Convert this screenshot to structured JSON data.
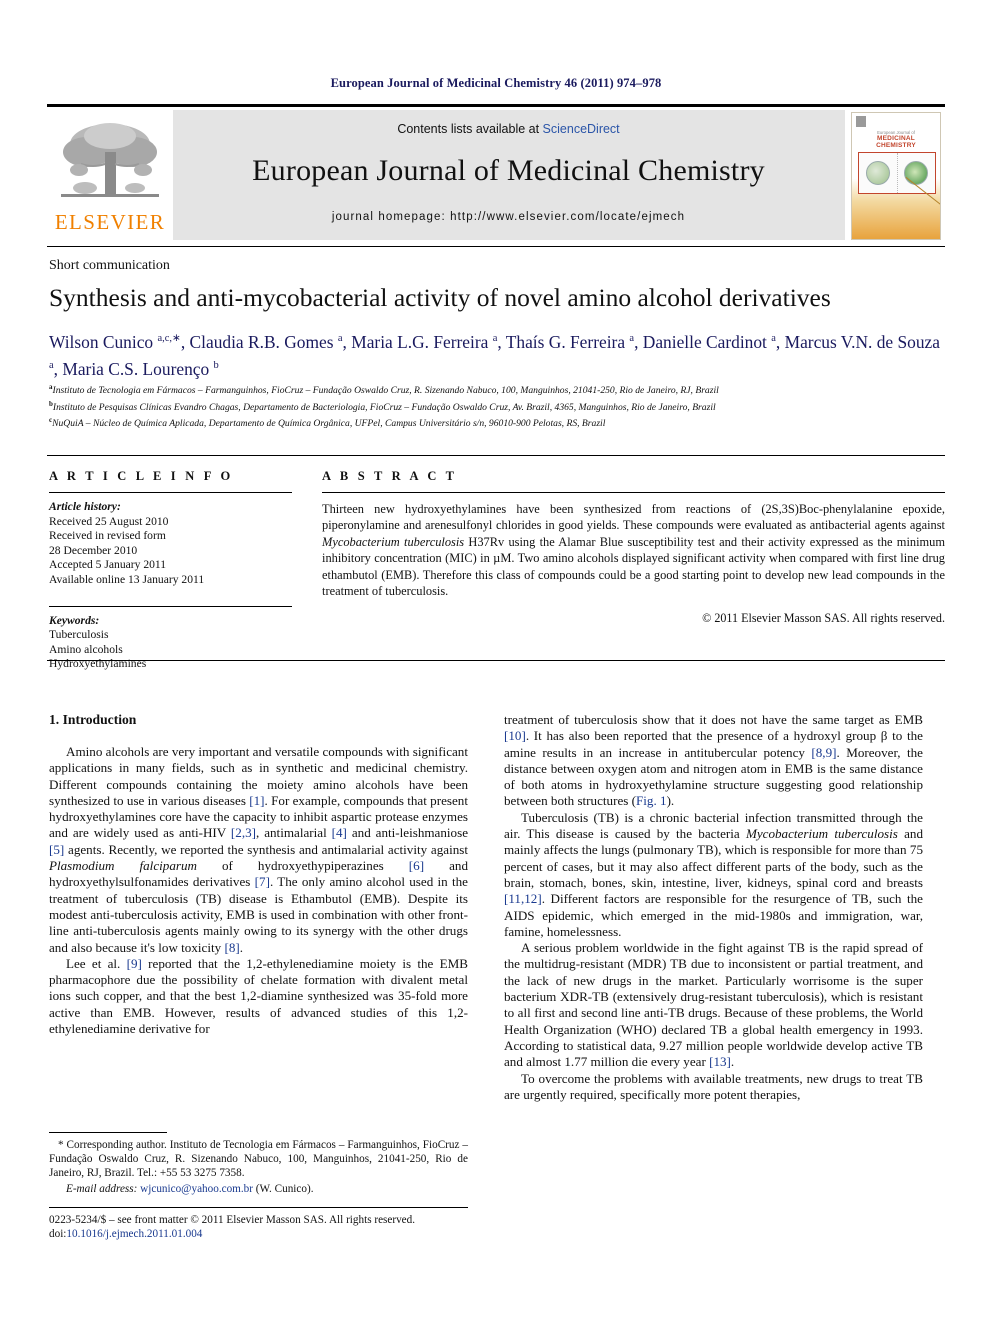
{
  "running_head": "European Journal of Medicinal Chemistry 46 (2011) 974–978",
  "masthead": {
    "publisher_name": "ELSEVIER",
    "contents_prefix": "Contents lists available at ",
    "contents_link": "ScienceDirect",
    "journal_title": "European Journal of Medicinal Chemistry",
    "journal_homepage": "journal homepage: http://www.elsevier.com/locate/ejmech",
    "cover_journal_small": "European Journal of",
    "cover_journal_big": "MEDICINAL CHEMISTRY"
  },
  "article": {
    "type_label": "Short communication",
    "title": "Synthesis and anti-mycobacterial activity of novel amino alcohol derivatives",
    "authors_html": "Wilson Cunico <sup>a,c,∗</sup>, Claudia R.B. Gomes <sup>a</sup>, Maria L.G. Ferreira <sup>a</sup>, Thaís G. Ferreira <sup>a</sup>, Danielle Cardinot <sup>a</sup>, Marcus V.N. de Souza <sup>a</sup>, Maria C.S. Lourenço <sup>b</sup>",
    "affiliations": [
      "Instituto de Tecnologia em Fármacos – Farmanguinhos, FioCruz – Fundação Oswaldo Cruz, R. Sizenando Nabuco, 100, Manguinhos, 21041-250, Rio de Janeiro, RJ, Brazil",
      "Instituto de Pesquisas Clínicas Evandro Chagas, Departamento de Bacteriologia, FioCruz – Fundação Oswaldo Cruz, Av. Brazil, 4365, Manguinhos, Rio de Janeiro, Brazil",
      "NuQuiA – Núcleo de Química Aplicada, Departamento de Química Orgânica, UFPel, Campus Universitário s/n, 96010-900 Pelotas, RS, Brazil"
    ],
    "affiliation_marks": [
      "a",
      "b",
      "c"
    ]
  },
  "article_info": {
    "label": "A R T I C L E    I N F O",
    "history_header": "Article history:",
    "history": [
      "Received 25 August 2010",
      "Received in revised form",
      "28 December 2010",
      "Accepted 5 January 2011",
      "Available online 13 January 2011"
    ],
    "keywords_header": "Keywords:",
    "keywords": [
      "Tuberculosis",
      "Amino alcohols",
      "Hydroxyethylamines"
    ]
  },
  "abstract": {
    "label": "A B S T R A C T",
    "paragraph_html": "Thirteen new hydroxyethylamines have been synthesized from reactions of (2S,3S)Boc-phenylalanine epoxide, piperonylamine and arenesulfonyl chlorides in good yields. These compounds were evaluated as antibacterial agents against <i>Mycobacterium tuberculosis</i> H37Rv using the Alamar Blue susceptibility test and their activity expressed as the minimum inhibitory concentration (MIC) in µM. Two amino alcohols displayed significant activity when compared with first line drug ethambutol (EMB). Therefore this class of compounds could be a good starting point to develop new lead compounds in the treatment of tuberculosis.",
    "copyright": "© 2011 Elsevier Masson SAS. All rights reserved."
  },
  "body": {
    "section_heading": "1. Introduction",
    "left_paragraphs_html": [
      "Amino alcohols are very important and versatile compounds with significant applications in many fields, such as in synthetic and medicinal chemistry. Different compounds containing the moiety amino alcohols have been synthesized to use in various diseases <span class=\"ref\">[1]</span>. For example, compounds that present hydroxyethylamines core have the capacity to inhibit aspartic protease enzymes and are widely used as anti-HIV <span class=\"ref\">[2,3]</span>, antimalarial <span class=\"ref\">[4]</span> and anti-leishmaniose <span class=\"ref\">[5]</span> agents. Recently, we reported the synthesis and antimalarial activity against <i>Plasmodium falciparum</i> of hydroxyethypiperazines <span class=\"ref\">[6]</span> and hydroxyethylsulfonamides derivatives <span class=\"ref\">[7]</span>. The only amino alcohol used in the treatment of tuberculosis (TB) disease is Ethambutol (EMB). Despite its modest anti-tuberculosis activity, EMB is used in combination with other front-line anti-tuberculosis agents mainly owing to its synergy with the other drugs and also because it's low toxicity <span class=\"ref\">[8]</span>.",
      "Lee et al. <span class=\"ref\">[9]</span> reported that the 1,2-ethylenediamine moiety is the EMB pharmacophore due the possibility of chelate formation with divalent metal ions such copper, and that the best 1,2-diamine synthesized was 35-fold more active than EMB. However, results of advanced studies of this 1,2-ethylenediamine derivative for"
    ],
    "right_paragraphs_html": [
      "treatment of tuberculosis show that it does not have the same target as EMB <span class=\"ref\">[10]</span>. It has also been reported that the presence of a hydroxyl group β to the amine results in an increase in antitubercular potency <span class=\"ref\">[8,9]</span>. Moreover, the distance between oxygen atom and nitrogen atom in EMB is the same distance of both atoms in hydroxyethylamine structure suggesting good relationship between both structures (<span class=\"ref\">Fig. 1</span>).",
      "Tuberculosis (TB) is a chronic bacterial infection transmitted through the air. This disease is caused by the bacteria <i>Mycobacterium tuberculosis</i> and mainly affects the lungs (pulmonary TB), which is responsible for more than 75 percent of cases, but it may also affect different parts of the body, such as the brain, stomach, bones, skin, intestine, liver, kidneys, spinal cord and breasts <span class=\"ref\">[11,12]</span>. Different factors are responsible for the resurgence of TB, such the AIDS epidemic, which emerged in the mid-1980s and immigration, war, famine, homelessness.",
      "A serious problem worldwide in the fight against TB is the rapid spread of the multidrug-resistant (MDR) TB due to inconsistent or partial treatment, and the lack of new drugs in the market. Particularly worrisome is the super bacterium XDR-TB (extensively drug-resistant tuberculosis), which is resistant to all first and second line anti-TB drugs. Because of these problems, the World Health Organization (WHO) declared TB a global health emergency in 1993. According to statistical data, 9.27 million people worldwide develop active TB and almost 1.77 million die every year <span class=\"ref\">[13]</span>.",
      "To overcome the problems with available treatments, new drugs to treat TB are urgently required, specifically more potent therapies,"
    ]
  },
  "footnote": {
    "corresponding_html": "* Corresponding author. Instituto de Tecnologia em Fármacos – Farmanguinhos, FioCruz – Fundação Oswaldo Cruz, R. Sizenando Nabuco, 100, Manguinhos, 21041-250, Rio de Janeiro, RJ, Brazil. Tel.: +55 53 3275 7358.",
    "email_label": "E-mail address:",
    "email": "wjcunico@yahoo.com.br",
    "email_owner": "(W. Cunico)."
  },
  "imprint": {
    "issn_line": "0223-5234/$ – see front matter © 2011 Elsevier Masson SAS. All rights reserved.",
    "doi_label": "doi:",
    "doi": "10.1016/j.ejmech.2011.01.004"
  },
  "colors": {
    "elsevier_orange": "#F08000",
    "link_blue": "#2b55a8",
    "ref_blue": "#1a3a8f",
    "author_navy": "#1a1a5e",
    "band_gray": "#e4e4e4"
  }
}
